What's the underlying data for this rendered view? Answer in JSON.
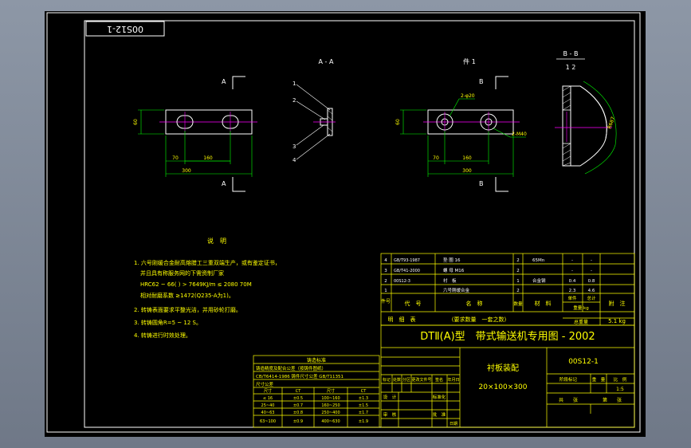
{
  "stamp": "00S12-1",
  "views": {
    "section_aa": "A - A",
    "part1": "件 1",
    "section_bb": "B - B",
    "scale_bb": "1 2",
    "mark_a": "A",
    "mark_b": "B"
  },
  "callouts": [
    "1",
    "2",
    "3",
    "4"
  ],
  "dims": {
    "height_60": "60",
    "x70": "70",
    "x160": "160",
    "width_300": "300",
    "holes_2x20": "2-φ20",
    "holes_2x40": "2-M40",
    "radius_687": "R687"
  },
  "notes": {
    "title": "说　明",
    "lines": [
      "1. 六号刚缓合金耐高熔腊工三重双端生产，或有鉴定证书，",
      "并且具有称服务网的下需资制厂家",
      "HRC62 ~ 66(  ) > 7649KJ/m  ≤ 2080 70M",
      "相对耐磨系数 ≥1472(Q235-A为1)。",
      "2. 转铸表面要求平整光洁，并用砂轮打磨。",
      "3. 转铸圆角R=5 ~ 12 S。",
      "4. 转铸进行时效处理。"
    ]
  },
  "small_table": {
    "title": "铸造标准",
    "rows": [
      "铸造精度及配合公差（按铸件图纸）",
      "CB/T6414-1986 铸件尺寸公差 GB/T11351",
      "尺寸公差"
    ],
    "cells": [
      [
        "尺寸",
        "CT",
        "尺寸",
        "CT"
      ],
      [
        "≤ 16",
        "±0.5",
        "100~160",
        "±1.3"
      ],
      [
        "25~40",
        "±0.7",
        "160~250",
        "±1.5"
      ],
      [
        "40~63",
        "±0.8",
        "250~400",
        "±1.7"
      ],
      [
        "63~100",
        "±0.9",
        "400~630",
        "±1.9"
      ]
    ]
  },
  "bom": {
    "rows": [
      [
        "4",
        "GB/T93-1987",
        "垫 圈 16",
        "2",
        "65Mn",
        "-",
        "-"
      ],
      [
        "3",
        "GB/T41-2000",
        "螺 母 M16",
        "2",
        "",
        "-",
        "-"
      ],
      [
        "2",
        "00S12-3",
        "衬　板",
        "1",
        "合金钢",
        "0.4",
        "0.8"
      ],
      [
        "1",
        "",
        "六号刚缓合金",
        "2",
        "",
        "2.3",
        "4.6"
      ]
    ],
    "header": {
      "seq": "件号",
      "code": "代　号",
      "name": "名　称",
      "qty": "数量",
      "material": "材　料",
      "unit_weight": "单件",
      "total_weight": "总计",
      "weight_unit": "重量 kg",
      "remark": "附　注"
    },
    "detail_label": "明　细　表",
    "detail_note": "(要求数量　一套之数)",
    "total_label": "总重量",
    "total_value": "5.1 kg"
  },
  "title_block": {
    "main_title": "DTⅡ(A)型　带式输送机专用图 - 2002",
    "drawing_name": "衬板装配",
    "dimensions": "20×100×300",
    "drawing_no": "00S12-1",
    "stage": "阶段标记",
    "weight_label": "重　量",
    "scale_label": "比　例",
    "scale_value": "1:5",
    "sheet_total": "共　　张",
    "sheet_no": "第　　张",
    "design": "设　计",
    "check": "审　核",
    "standard": "标准化",
    "approve": "批　准",
    "revision": [
      "标记",
      "处数",
      "分区",
      "更改文件号",
      "签名",
      "年月日"
    ],
    "date": "日期"
  }
}
